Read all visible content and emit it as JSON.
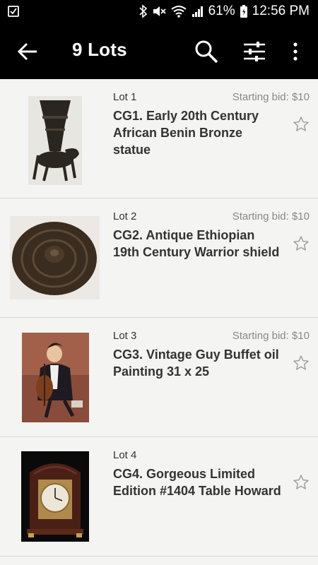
{
  "status_bar": {
    "battery": "61%",
    "time": "12:56 PM",
    "icons": [
      "checklist-icon",
      "bluetooth-icon",
      "mute-icon",
      "wifi-icon",
      "signal-icon",
      "battery-icon"
    ]
  },
  "app_bar": {
    "title": "9 Lots",
    "icons": [
      "back-arrow-icon",
      "search-icon",
      "filter-icon",
      "more-vert-icon"
    ]
  },
  "lots": [
    {
      "lot_number": "Lot 1",
      "starting_bid": "Starting bid: $10",
      "name": "CG1.  Early 20th Century African Benin Bronze statue",
      "image": "bronze-statue-thumbnail"
    },
    {
      "lot_number": "Lot 2",
      "starting_bid": "Starting bid: $10",
      "name": "CG2. Antique Ethiopian 19th Century Warrior shield",
      "image": "warrior-shield-thumbnail"
    },
    {
      "lot_number": "Lot 3",
      "starting_bid": "Starting bid: $10",
      "name": "CG3. Vintage Guy Buffet oil Painting 31 x 25",
      "image": "oil-painting-thumbnail"
    },
    {
      "lot_number": "Lot 4",
      "starting_bid": "",
      "name": "CG4. Gorgeous Limited Edition #1404 Table Howard",
      "image": "table-clock-thumbnail"
    }
  ]
}
